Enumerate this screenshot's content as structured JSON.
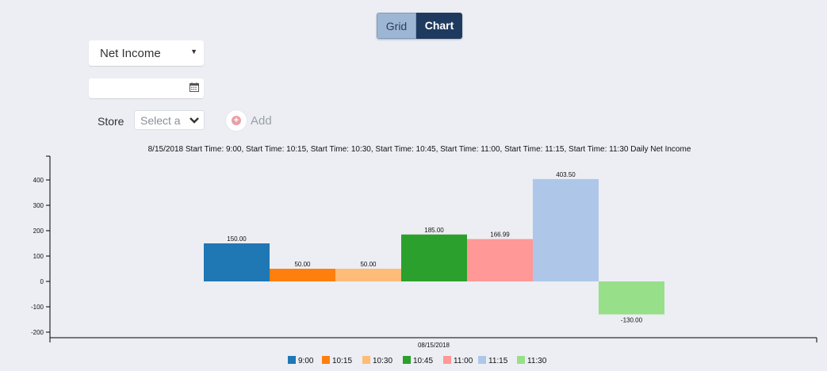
{
  "toggle": {
    "grid_label": "Grid",
    "chart_label": "Chart",
    "active": "Chart"
  },
  "metric_select": {
    "value": "Net Income"
  },
  "date_field": {
    "value": ""
  },
  "store_filter": {
    "label": "Store",
    "placeholder": "Select a"
  },
  "add_button": {
    "label": "Add"
  },
  "chart_data": {
    "type": "bar",
    "title": "8/15/2018 Start Time: 9:00, Start Time: 10:15, Start Time: 10:30, Start Time: 10:45, Start Time: 11:00, Start Time: 11:15, Start Time: 11:30 Daily Net Income",
    "categories": [
      "08/15/2018"
    ],
    "series": [
      {
        "name": "9:00",
        "values": [
          150
        ],
        "color": "#1f77b4",
        "label": "150.00"
      },
      {
        "name": "10:15",
        "values": [
          50
        ],
        "color": "#ff7f0e",
        "label": "50.00"
      },
      {
        "name": "10:30",
        "values": [
          50
        ],
        "color": "#ffbb78",
        "label": "50.00"
      },
      {
        "name": "10:45",
        "values": [
          185
        ],
        "color": "#2ca02c",
        "label": "185.00"
      },
      {
        "name": "11:00",
        "values": [
          166.99
        ],
        "color": "#ff9896",
        "label": "166.99"
      },
      {
        "name": "11:15",
        "values": [
          403.5
        ],
        "color": "#aec7e8",
        "label": "403.50"
      },
      {
        "name": "11:30",
        "values": [
          -130
        ],
        "color": "#98df8a",
        "label": "-130.00"
      }
    ],
    "ylim": [
      -200,
      400
    ],
    "yticks": [
      -200,
      -100,
      0,
      100,
      200,
      300,
      400
    ],
    "grid": false,
    "legend": "bottom"
  }
}
